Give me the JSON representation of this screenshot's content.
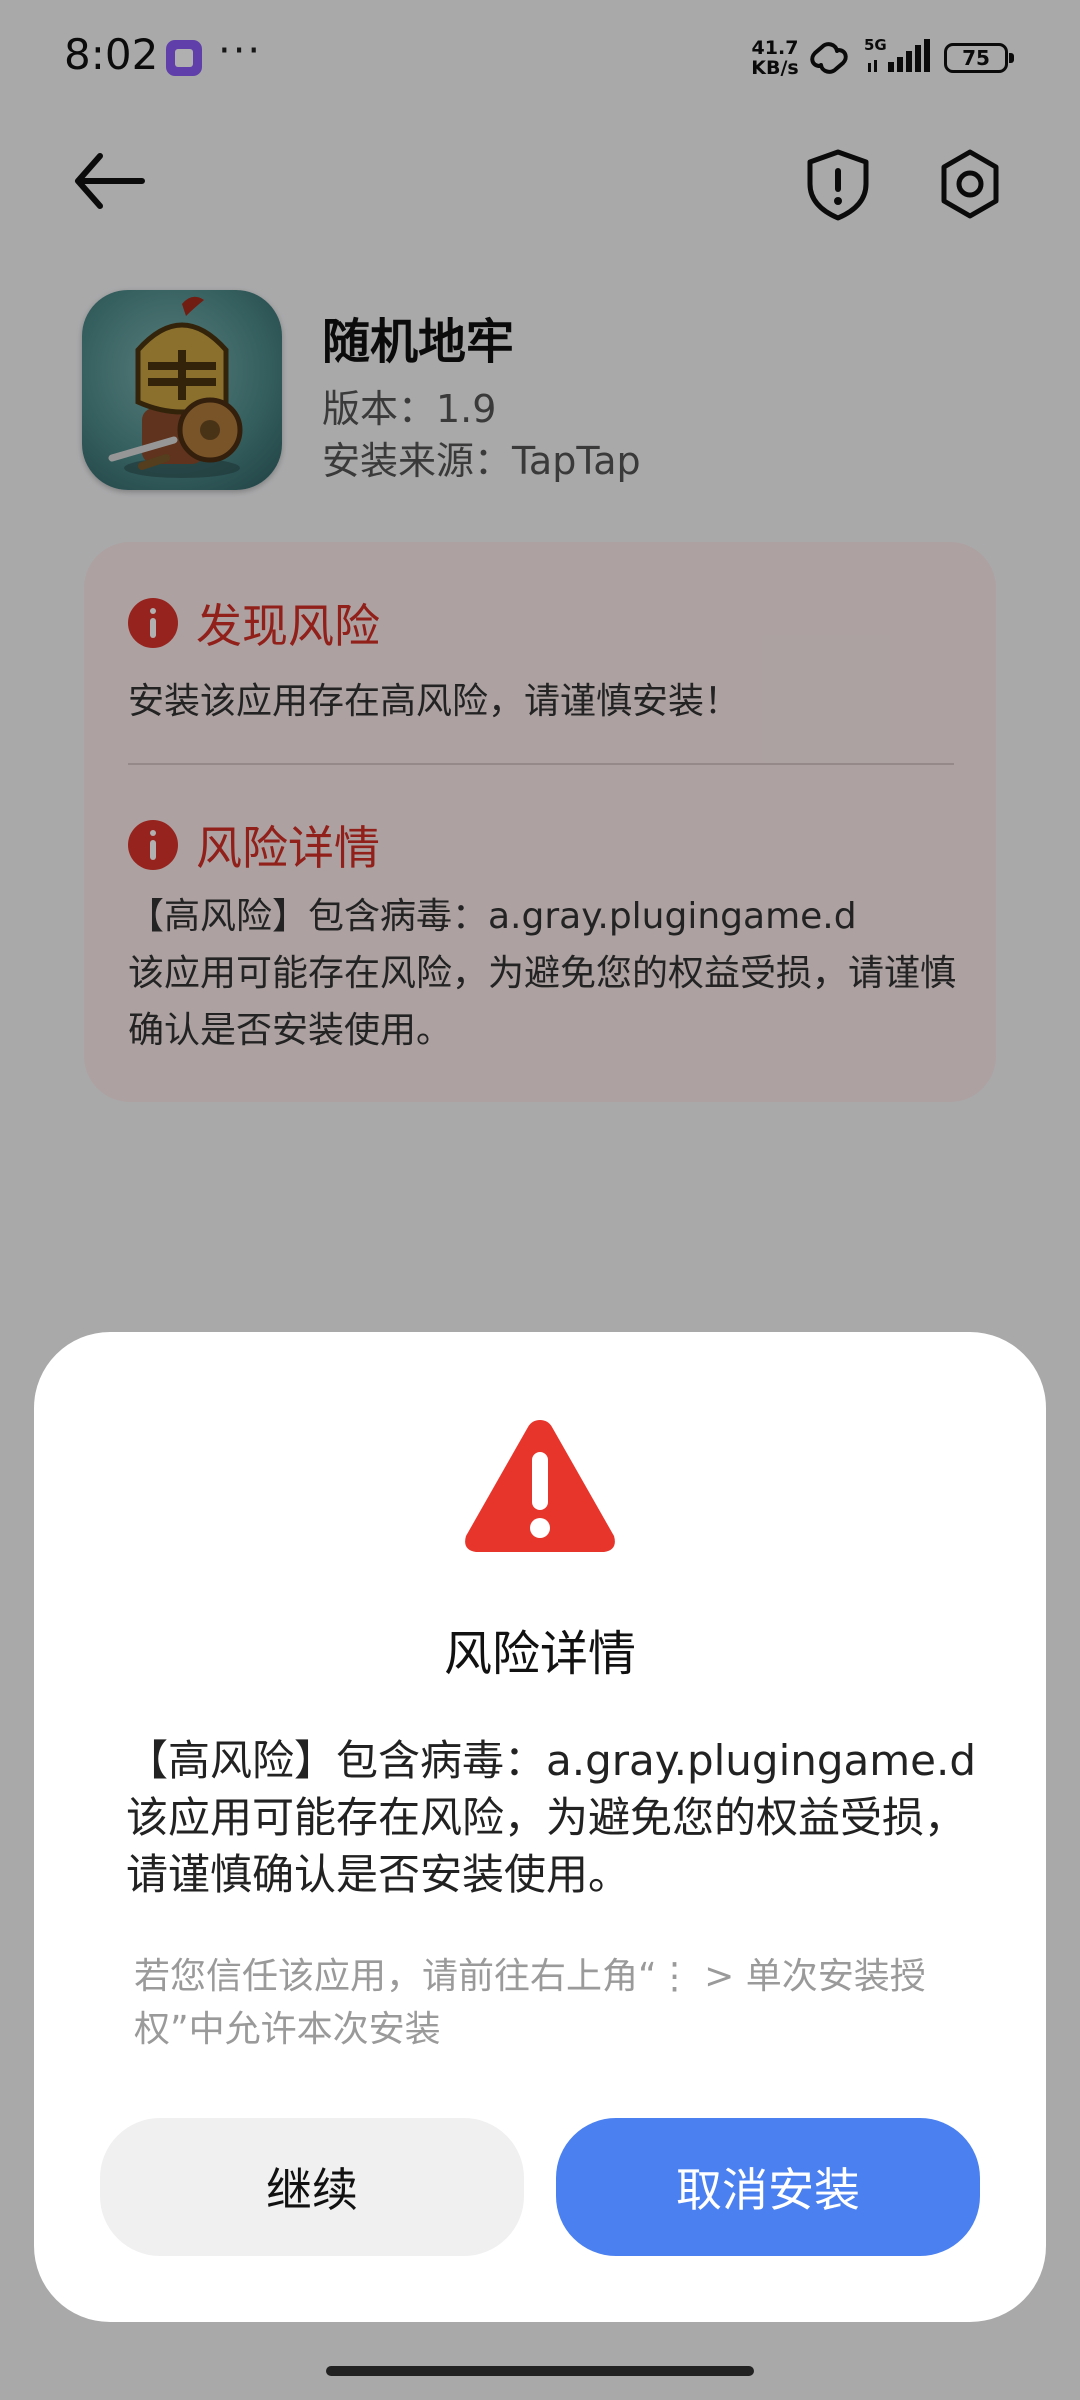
{
  "status_bar": {
    "time": "8:02",
    "more": "···",
    "net_speed_value": "41.7",
    "net_speed_unit": "KB/s",
    "network_type": "5G",
    "battery": "75"
  },
  "app": {
    "name": "随机地牢",
    "version": "版本：1.9",
    "source": "安装来源：TapTap"
  },
  "risk_card": {
    "found_title": "发现风险",
    "found_desc": "安装该应用存在高风险，请谨慎安装！",
    "detail_title": "风险详情",
    "detail_line1": "【高风险】包含病毒：a.gray.plugingame.d",
    "detail_line2": "该应用可能存在风险，为避免您的权益受损，请谨慎确认是否安装使用。"
  },
  "dialog": {
    "title": "风险详情",
    "body_line1": "【高风险】包含病毒：a.gray.plugingame.d",
    "body_line2": "该应用可能存在风险，为避免您的权益受损，请谨慎确认是否安装使用。",
    "hint": "若您信任该应用，请前往右上角“⋮ > 单次安装授权”中允许本次安装",
    "continue_label": "继续",
    "cancel_label": "取消安装"
  },
  "colors": {
    "risk_red": "#d22f26",
    "primary_blue": "#4a80f0",
    "warning_red": "#e8352b"
  },
  "icons": {
    "back": "back-arrow-icon",
    "shield": "shield-alert-icon",
    "settings": "gear-icon",
    "risk": "info-alert-icon",
    "dialog_warning": "warning-triangle-icon"
  }
}
